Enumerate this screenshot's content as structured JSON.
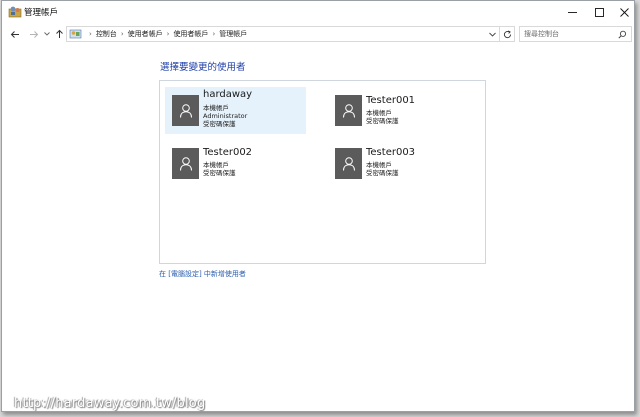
{
  "window": {
    "title": "管理帳戶",
    "icon": "user-accounts-icon"
  },
  "nav": {
    "breadcrumbs": [
      "控制台",
      "使用者帳戶",
      "使用者帳戶",
      "管理帳戶"
    ]
  },
  "search": {
    "placeholder": "搜尋控制台"
  },
  "main": {
    "heading": "選擇要變更的使用者",
    "users": [
      {
        "name": "hardaway",
        "lines": [
          "本機帳戶",
          "Administrator",
          "受密碼保護"
        ],
        "selected": true
      },
      {
        "name": "Tester001",
        "lines": [
          "本機帳戶",
          "受密碼保護"
        ],
        "selected": false
      },
      {
        "name": "Tester002",
        "lines": [
          "本機帳戶",
          "受密碼保護"
        ],
        "selected": false
      },
      {
        "name": "Tester003",
        "lines": [
          "本機帳戶",
          "受密碼保護"
        ],
        "selected": false
      }
    ],
    "add_user_link": "在 [電腦設定] 中新增使用者"
  },
  "watermark": "http://hardaway.com.tw/blog",
  "colors": {
    "accent": "#1f3fa8",
    "link": "#2d5fb0",
    "selection": "#e5f1fb",
    "avatar": "#5b5b5b"
  }
}
